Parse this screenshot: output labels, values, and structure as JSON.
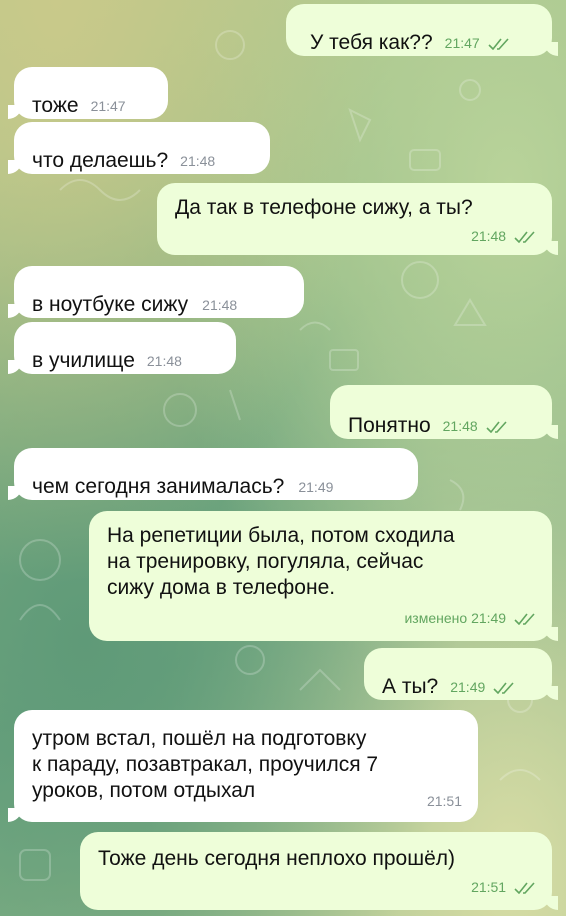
{
  "colors": {
    "incoming_bubble": "#ffffff",
    "outgoing_bubble": "#eefed9",
    "outgoing_meta": "#62a660",
    "incoming_meta": "#8a9099"
  },
  "icons": {
    "read_status": "double-check-icon"
  },
  "messages": [
    {
      "dir": "out",
      "text": "У тебя как??",
      "time": "21:47",
      "edited": ""
    },
    {
      "dir": "in",
      "text": "тоже",
      "time": "21:47"
    },
    {
      "dir": "in",
      "text": "что делаешь?",
      "time": "21:48"
    },
    {
      "dir": "out",
      "text": "Да так в телефоне сижу, а ты?",
      "time": "21:48"
    },
    {
      "dir": "in",
      "text": "в ноутбуке сижу",
      "time": "21:48"
    },
    {
      "dir": "in",
      "text": "в училище",
      "time": "21:48"
    },
    {
      "dir": "out",
      "text": "Понятно",
      "time": "21:48"
    },
    {
      "dir": "in",
      "text": "чем сегодня занималась?",
      "time": "21:49"
    },
    {
      "dir": "out",
      "text": "На репетиции была, потом сходила\nна тренировку, погуляла, сейчас\nсижу дома в телефоне.",
      "time": "21:49",
      "edited": "изменено"
    },
    {
      "dir": "out",
      "text": "А ты?",
      "time": "21:49"
    },
    {
      "dir": "in",
      "text": "утром встал, пошёл на подготовку\nк параду, позавтракал, проучился 7\nуроков, потом отдыхал",
      "time": "21:51"
    },
    {
      "dir": "out",
      "text": "Тоже день сегодня неплохо прошёл)",
      "time": "21:51"
    }
  ]
}
